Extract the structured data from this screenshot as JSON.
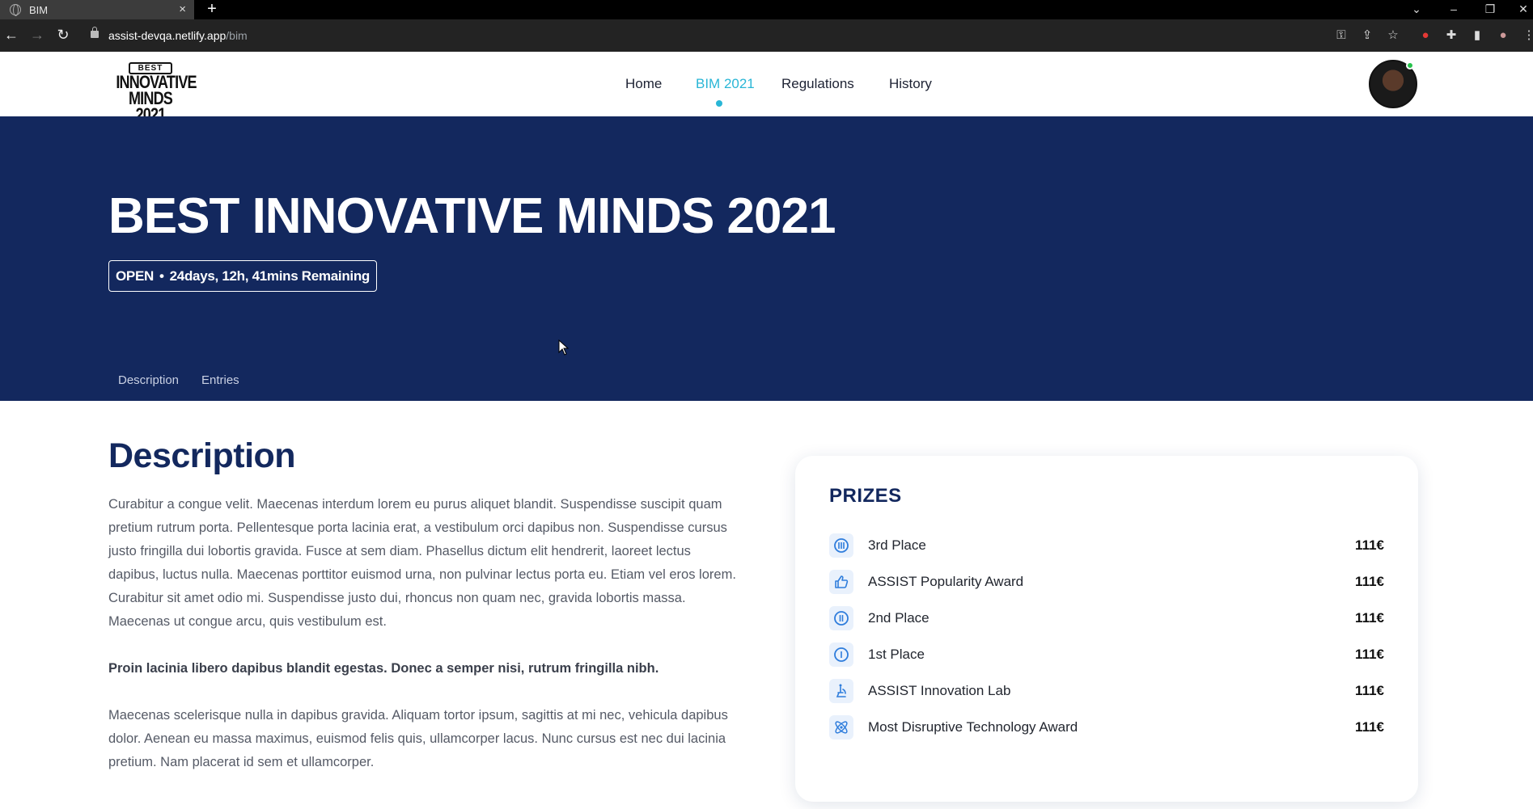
{
  "browser": {
    "tab_title": "BIM",
    "url_host": "assist-devqa.netlify.app",
    "url_path": "/bim"
  },
  "logo": {
    "ribbon": "BEST",
    "line1": "INNOVATIVE",
    "line2": "MINDS 2021"
  },
  "nav": {
    "items": [
      "Home",
      "BIM 2021",
      "Regulations",
      "History"
    ],
    "active": "BIM 2021"
  },
  "hero": {
    "title": "BEST INNOVATIVE MINDS 2021",
    "status": "OPEN",
    "separator": "•",
    "remaining": "24days, 12h, 41mins Remaining",
    "tabs": [
      "Description",
      "Entries"
    ]
  },
  "description": {
    "heading": "Description",
    "paragraph1": "Curabitur a congue velit. Maecenas interdum lorem eu purus aliquet blandit. Suspendisse suscipit quam pretium rutrum porta. Pellentesque porta lacinia erat, a vestibulum orci dapibus non. Suspendisse cursus justo fringilla dui lobortis gravida. Fusce at sem diam. Phasellus dictum elit hendrerit, laoreet lectus dapibus, luctus nulla. Maecenas porttitor euismod urna, non pulvinar lectus porta eu. Etiam vel eros lorem. Curabitur sit amet odio mi. Suspendisse justo dui, rhoncus non quam nec, gravida lobortis massa. Maecenas ut congue arcu, quis vestibulum est.",
    "paragraph2": "Proin lacinia libero dapibus blandit egestas. Donec a semper nisi, rutrum fringilla nibh.",
    "paragraph3": "Maecenas scelerisque nulla in dapibus gravida. Aliquam tortor ipsum, sagittis at mi nec, vehicula dapibus dolor. Aenean eu massa maximus, euismod felis quis, ullamcorper lacus. Nunc cursus est nec dui lacinia pretium. Nam placerat id sem et ullamcorper."
  },
  "prizes": {
    "title": "PRIZES",
    "items": [
      {
        "name": "3rd Place",
        "value": "111€",
        "icon": "medal-three-icon"
      },
      {
        "name": "ASSIST Popularity Award",
        "value": "111€",
        "icon": "thumbs-up-icon"
      },
      {
        "name": "2nd Place",
        "value": "111€",
        "icon": "medal-two-icon"
      },
      {
        "name": "1st Place",
        "value": "111€",
        "icon": "medal-one-icon"
      },
      {
        "name": "ASSIST Innovation Lab",
        "value": "111€",
        "icon": "microscope-icon"
      },
      {
        "name": "Most Disruptive Technology Award",
        "value": "111€",
        "icon": "atom-icon"
      }
    ]
  },
  "colors": {
    "hero_bg": "#13285e",
    "accent": "#29b6d6",
    "heading": "#13285e",
    "icon_blue": "#2f7ddc"
  }
}
